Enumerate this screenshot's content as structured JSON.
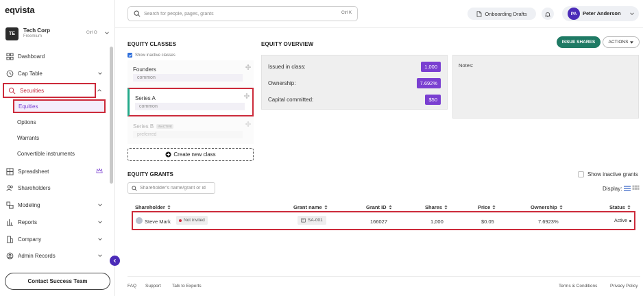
{
  "brand": {
    "logo": "eqvista"
  },
  "org": {
    "initials": "TE",
    "name": "Tech Corp",
    "plan": "Freemium",
    "shortcut": "Ctrl O"
  },
  "sidebar": {
    "items": [
      {
        "label": "Dashboard"
      },
      {
        "label": "Cap Table"
      },
      {
        "label": "Securities"
      },
      {
        "label": "Spreadsheet"
      },
      {
        "label": "Shareholders"
      },
      {
        "label": "Modeling"
      },
      {
        "label": "Reports"
      },
      {
        "label": "Company"
      },
      {
        "label": "Admin Records"
      }
    ],
    "securities_sub": [
      {
        "label": "Equities"
      },
      {
        "label": "Options"
      },
      {
        "label": "Warrants"
      },
      {
        "label": "Convertible instruments"
      }
    ],
    "contact_label": "Contact Success Team"
  },
  "topbar": {
    "search_placeholder": "Search for people, pages, grants",
    "search_shortcut": "Ctrl K",
    "drafts_label": "Onboarding Drafts",
    "user_initials": "PA",
    "user_name": "Peter Anderson"
  },
  "equity_classes": {
    "title": "EQUITY CLASSES",
    "show_inactive": "Show inactive classes",
    "classes": [
      {
        "name": "Founders",
        "type": "common"
      },
      {
        "name": "Series A",
        "type": "common"
      },
      {
        "name": "Series B",
        "type": "preferred",
        "badge": "INACTIVE"
      }
    ],
    "create_label": "Create new class"
  },
  "overview": {
    "title": "EQUITY OVERVIEW",
    "issued_label": "Issued in class:",
    "issued_value": "1,000",
    "ownership_label": "Ownership:",
    "ownership_value": "7.692%",
    "committed_label": "Capital committed:",
    "committed_value": "$50",
    "notes_label": "Notes:",
    "issue_label": "ISSUE SHARES",
    "actions_label": "ACTIONS"
  },
  "grants": {
    "title": "EQUITY GRANTS",
    "search_placeholder": "Shareholder's name/grant or id",
    "show_inactive": "Show inactive grants",
    "display_label": "Display:",
    "columns": [
      "Shareholder",
      "Grant name",
      "Grant ID",
      "Shares",
      "Price",
      "Ownership",
      "Status"
    ],
    "rows": [
      {
        "shareholder": "Steve Mark",
        "invite": "Not invited",
        "grant_name": "SA-001",
        "grant_id": "166027",
        "shares": "1,000",
        "price": "$0.05",
        "ownership": "7.6923%",
        "status": "Active"
      }
    ]
  },
  "footer": {
    "faq": "FAQ",
    "support": "Support",
    "experts": "Talk to Experts",
    "terms": "Terms & Conditions",
    "privacy": "Privacy Policy"
  },
  "colors": {
    "accent": "#7a3fd1",
    "brand_dark": "#4b2bb8",
    "issue_green": "#1f7a64",
    "highlight_red": "#cc2a3a"
  }
}
